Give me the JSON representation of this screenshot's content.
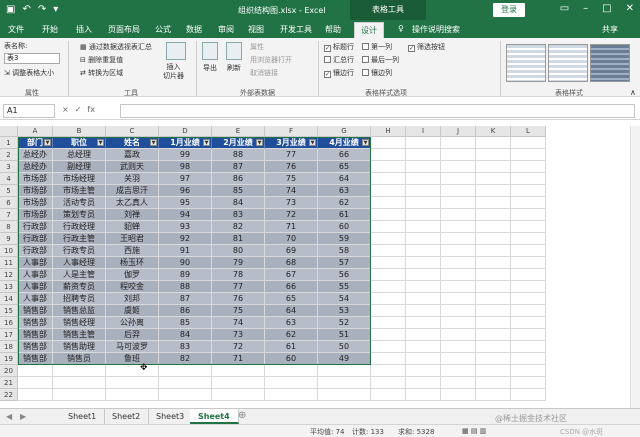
{
  "titlebar": {
    "filename": "组织结构图.xlsx - Excel",
    "context_tab": "表格工具",
    "login": "登录",
    "colors": {
      "green": "#217346"
    }
  },
  "tabs": [
    "文件",
    "开始",
    "插入",
    "页面布局",
    "公式",
    "数据",
    "审阅",
    "视图",
    "开发工具",
    "帮助",
    "设计",
    "操作说明搜索",
    "共享"
  ],
  "ribbon": {
    "props": {
      "label": "表名称:",
      "name_value": "表3",
      "resize": "调整表格大小",
      "group": "属性"
    },
    "tools": {
      "pivot": "通过数据透视表汇总",
      "dedupe": "删除重复值",
      "convert": "转换为区域",
      "slicer": "插入\n切片器",
      "group": "工具"
    },
    "external": {
      "export": "导出",
      "refresh": "刷新",
      "props": "属性",
      "open_browser": "用浏览器打开",
      "unlink": "取消链接",
      "group": "外部表数据"
    },
    "style_opts": {
      "header_row": "标题行",
      "first_col": "第一列",
      "filter_btn": "筛选按钮",
      "total_row": "汇总行",
      "last_col": "最后一列",
      "banded_rows": "镶边行",
      "banded_cols": "镶边列",
      "group": "表格样式选项"
    },
    "styles_group": "表格样式"
  },
  "formula": {
    "namebox": "A1",
    "fx": "fx",
    "cancel": "×",
    "ok": "✓"
  },
  "columns": [
    "A",
    "B",
    "C",
    "D",
    "E",
    "F",
    "G",
    "H",
    "I",
    "J",
    "K",
    "L"
  ],
  "table": {
    "headers": [
      "部门",
      "职位",
      "姓名",
      "1月业绩",
      "2月业绩",
      "3月业绩",
      "4月业绩"
    ],
    "rows": [
      [
        "总经办",
        "总经理",
        "嘉政",
        "99",
        "88",
        "77",
        "66"
      ],
      [
        "总经办",
        "副经理",
        "武则天",
        "98",
        "87",
        "76",
        "65"
      ],
      [
        "市场部",
        "市场经理",
        "关羽",
        "97",
        "86",
        "75",
        "64"
      ],
      [
        "市场部",
        "市场主管",
        "成吉思汗",
        "96",
        "85",
        "74",
        "63"
      ],
      [
        "市场部",
        "活动专员",
        "太乙真人",
        "95",
        "84",
        "73",
        "62"
      ],
      [
        "市场部",
        "策划专员",
        "刘禅",
        "94",
        "83",
        "72",
        "61"
      ],
      [
        "行政部",
        "行政经理",
        "貂蝉",
        "93",
        "82",
        "71",
        "60"
      ],
      [
        "行政部",
        "行政主管",
        "王昭君",
        "92",
        "81",
        "70",
        "59"
      ],
      [
        "行政部",
        "行政专员",
        "西施",
        "91",
        "80",
        "69",
        "58"
      ],
      [
        "人事部",
        "人事经理",
        "杨玉环",
        "90",
        "79",
        "68",
        "57"
      ],
      [
        "人事部",
        "人是主管",
        "伽罗",
        "89",
        "78",
        "67",
        "56"
      ],
      [
        "人事部",
        "薪资专员",
        "程咬金",
        "88",
        "77",
        "66",
        "55"
      ],
      [
        "人事部",
        "招聘专员",
        "刘邦",
        "87",
        "76",
        "65",
        "54"
      ],
      [
        "销售部",
        "销售总监",
        "虞姬",
        "86",
        "75",
        "64",
        "53"
      ],
      [
        "销售部",
        "销售经理",
        "公孙离",
        "85",
        "74",
        "63",
        "52"
      ],
      [
        "销售部",
        "销售主管",
        "后羿",
        "84",
        "73",
        "62",
        "51"
      ],
      [
        "销售部",
        "销售助理",
        "马可波罗",
        "83",
        "72",
        "61",
        "50"
      ],
      [
        "销售部",
        "销售员",
        "鲁班",
        "82",
        "71",
        "60",
        "49"
      ]
    ],
    "colors": {
      "header": "#1f4e9a",
      "band": "#b6bcc8"
    }
  },
  "row_numbers": [
    "1",
    "2",
    "3",
    "4",
    "5",
    "6",
    "7",
    "8",
    "9",
    "10",
    "11",
    "12",
    "13",
    "14",
    "15",
    "16",
    "17",
    "18",
    "19",
    "20",
    "21",
    "22"
  ],
  "sheets": [
    "Sheet1",
    "Sheet2",
    "Sheet3",
    "Sheet4"
  ],
  "active_sheet": "Sheet4",
  "status": {
    "avg": "平均值: 74",
    "count": "计数: 133",
    "sum": "求和: 5328",
    "watermark": "@稀土掘金技术社区",
    "watermark2": "CSDN @水斑"
  }
}
